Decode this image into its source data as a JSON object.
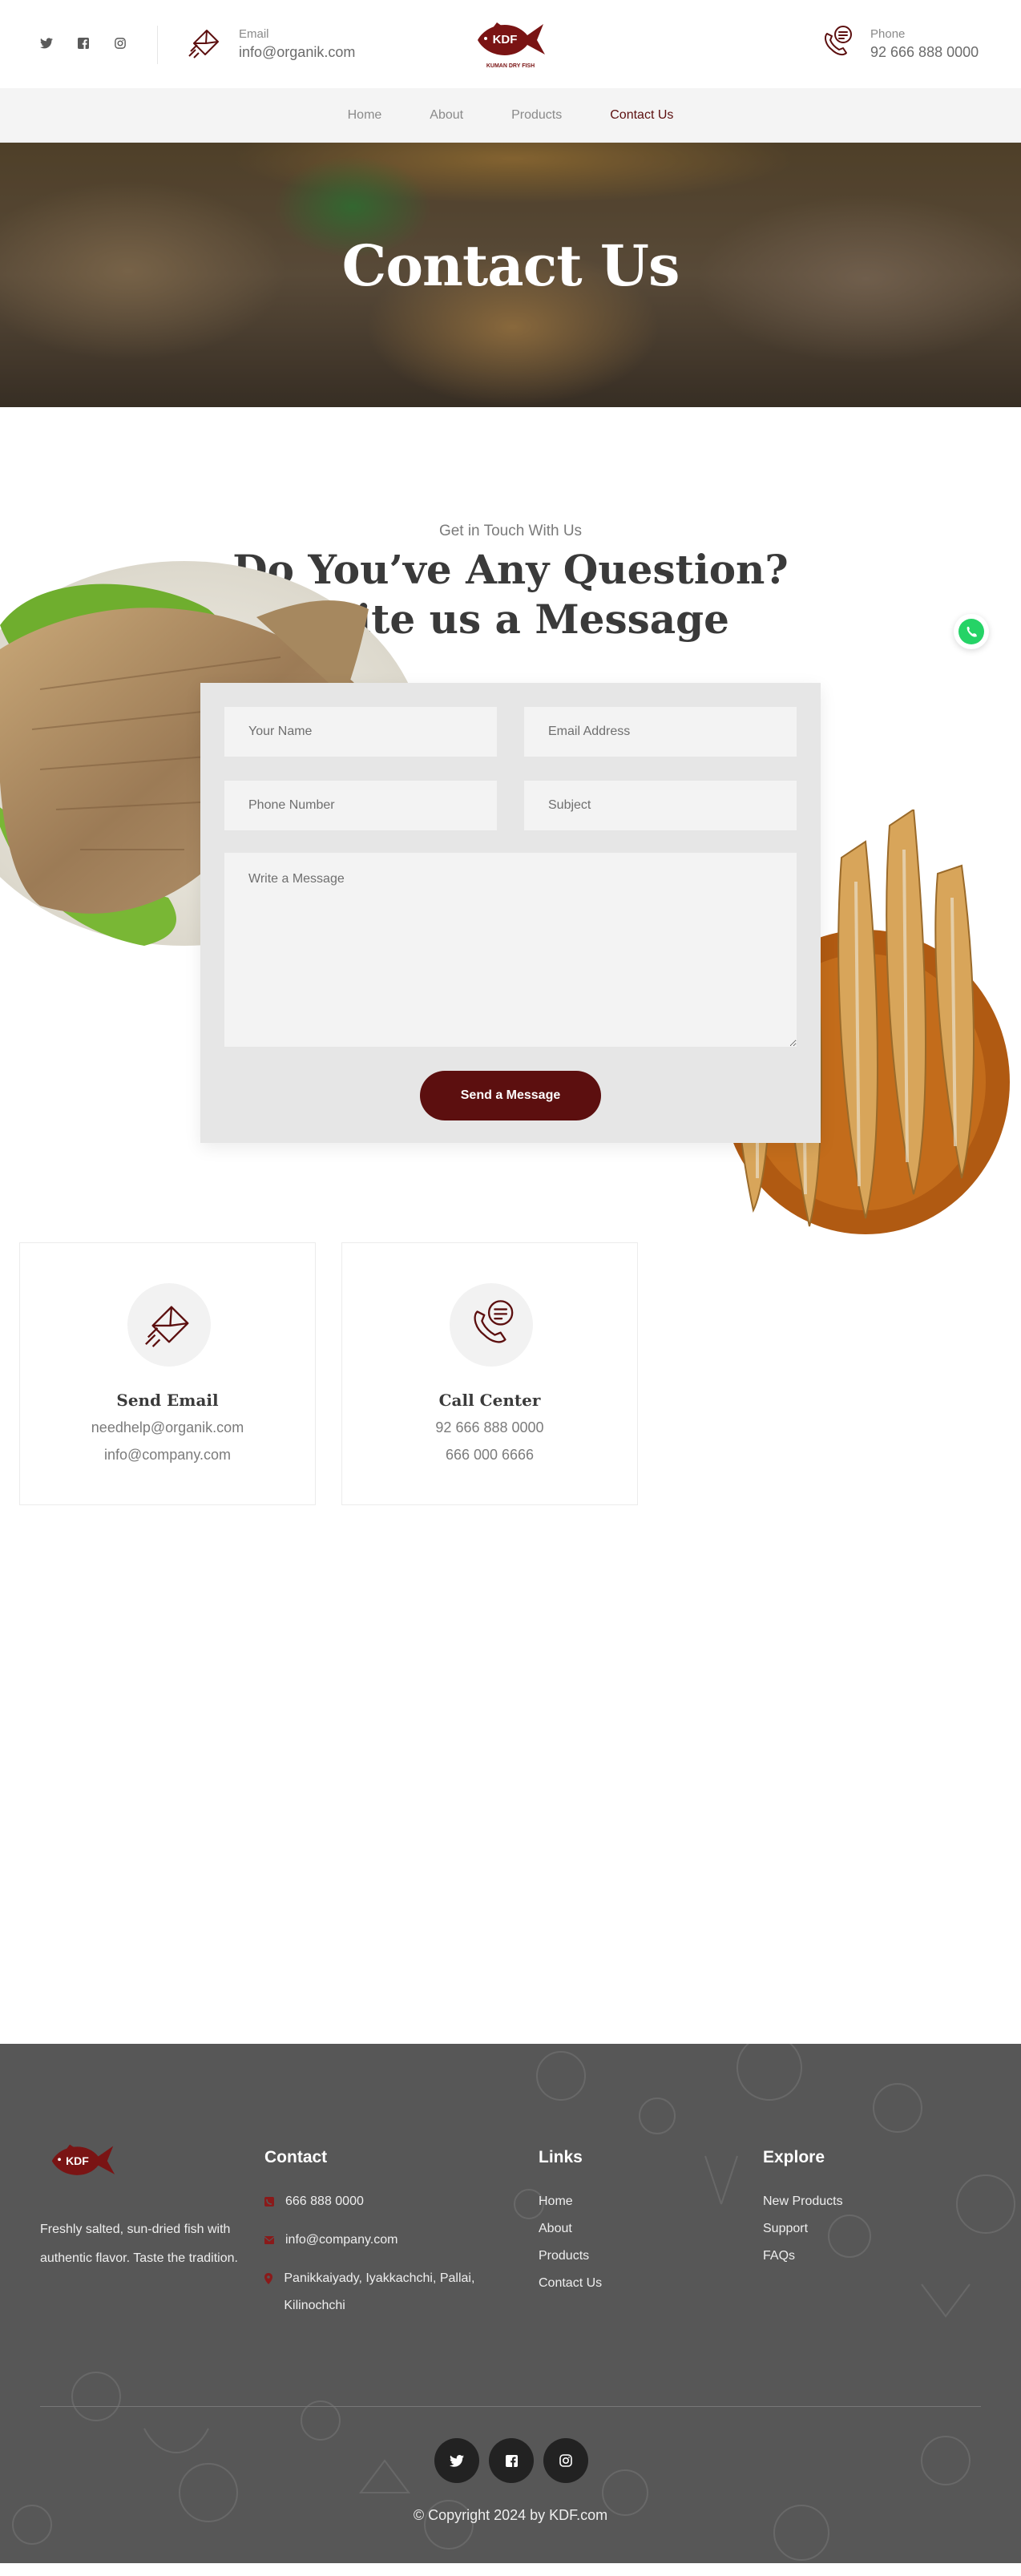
{
  "header": {
    "social": [
      {
        "icon": "twitter-icon"
      },
      {
        "icon": "facebook-icon"
      },
      {
        "icon": "instagram-icon"
      }
    ],
    "email_label": "Email",
    "email_value": "info@organik.com",
    "phone_label": "Phone",
    "phone_value": "92 666 888 0000",
    "logo": {
      "badge": "KDF",
      "tagline": "KUMAN DRY FISH"
    }
  },
  "nav": {
    "items": [
      {
        "label": "Home"
      },
      {
        "label": "About"
      },
      {
        "label": "Products"
      },
      {
        "label": "Contact Us"
      }
    ],
    "active": "Contact Us"
  },
  "hero": {
    "title": "Contact Us"
  },
  "contact_section": {
    "eyebrow": "Get in Touch With Us",
    "title_line1": "Do You’ve Any Question?",
    "title_line2": "Write us a Message"
  },
  "form": {
    "name_placeholder": "Your Name",
    "email_placeholder": "Email Address",
    "phone_placeholder": "Phone Number",
    "subject_placeholder": "Subject",
    "message_placeholder": "Write a Message",
    "submit_label": "Send a Message"
  },
  "info_cards": [
    {
      "title": "Send Email",
      "line1": "needhelp@organik.com",
      "line2": "info@company.com",
      "icon": "envelope-icon"
    },
    {
      "title": "Call Center",
      "line1": "92 666 888 0000",
      "line2": "666 000 6666",
      "icon": "phone-chat-icon"
    }
  ],
  "footer": {
    "logo_badge": "KDF",
    "description": "Freshly salted, sun-dried fish with authentic flavor. Taste the tradition.",
    "contact_heading": "Contact",
    "contact_phone": "666 888 0000",
    "contact_email": "info@company.com",
    "contact_address": "Panikkaiyady, Iyakkachchi, Pallai, Kilinochchi",
    "links_heading": "Links",
    "links": [
      {
        "label": "Home"
      },
      {
        "label": "About"
      },
      {
        "label": "Products"
      },
      {
        "label": "Contact Us"
      }
    ],
    "explore_heading": "Explore",
    "explore": [
      {
        "label": "New Products"
      },
      {
        "label": "Support"
      },
      {
        "label": "FAQs"
      }
    ],
    "copyright": "© Copyright 2024 by KDF.com"
  },
  "colors": {
    "brand": "#5c0f0f",
    "footer_bg": "#575757",
    "whatsapp": "#25d366"
  }
}
